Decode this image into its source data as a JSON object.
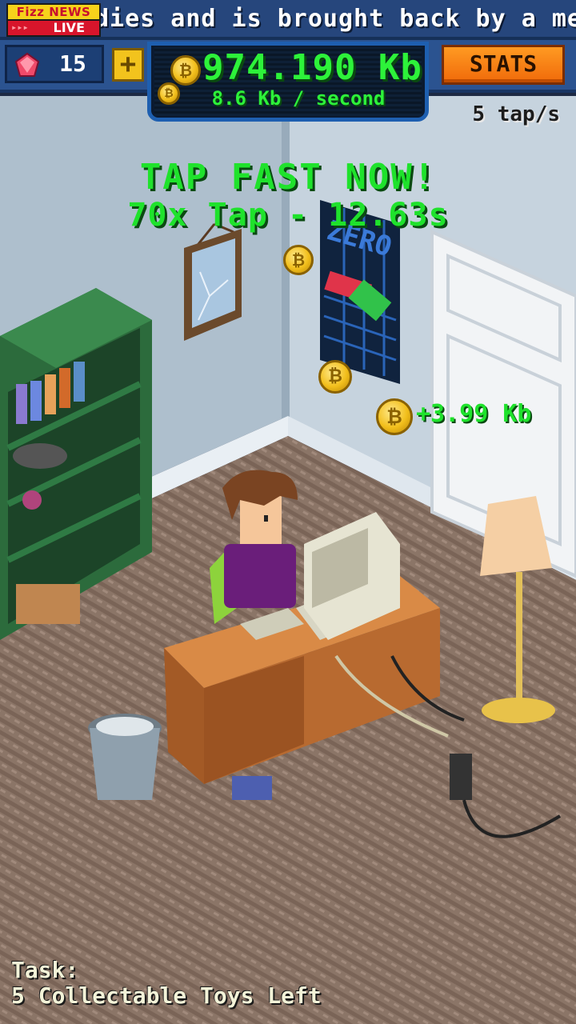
{
  "ticker": {
    "brand": "Fizz NEWS",
    "live": "LIVE",
    "headline": "dies and is brought back by a merma"
  },
  "hud": {
    "gems": "15",
    "plus_label": "+",
    "wallet_amount": "974.190 Kb",
    "wallet_rate": "8.6 Kb / second",
    "stats_label": "STATS",
    "tap_rate": "5 tap/s"
  },
  "event": {
    "title": "TAP FAST NOW!",
    "info": "70x Tap - 12.63s"
  },
  "floating_gain": "+3.99 Kb",
  "poster_text": "ZERO",
  "task": {
    "label": "Task:",
    "text": "5 Collectable Toys Left"
  },
  "colors": {
    "accent_green": "#1fe22c",
    "stats_orange": "#f58a16",
    "hud_blue": "#2b5390",
    "coin_gold": "#f2bf1c"
  },
  "icons": [
    "gem-icon",
    "plus-icon",
    "bitcoin-coin-icon"
  ]
}
